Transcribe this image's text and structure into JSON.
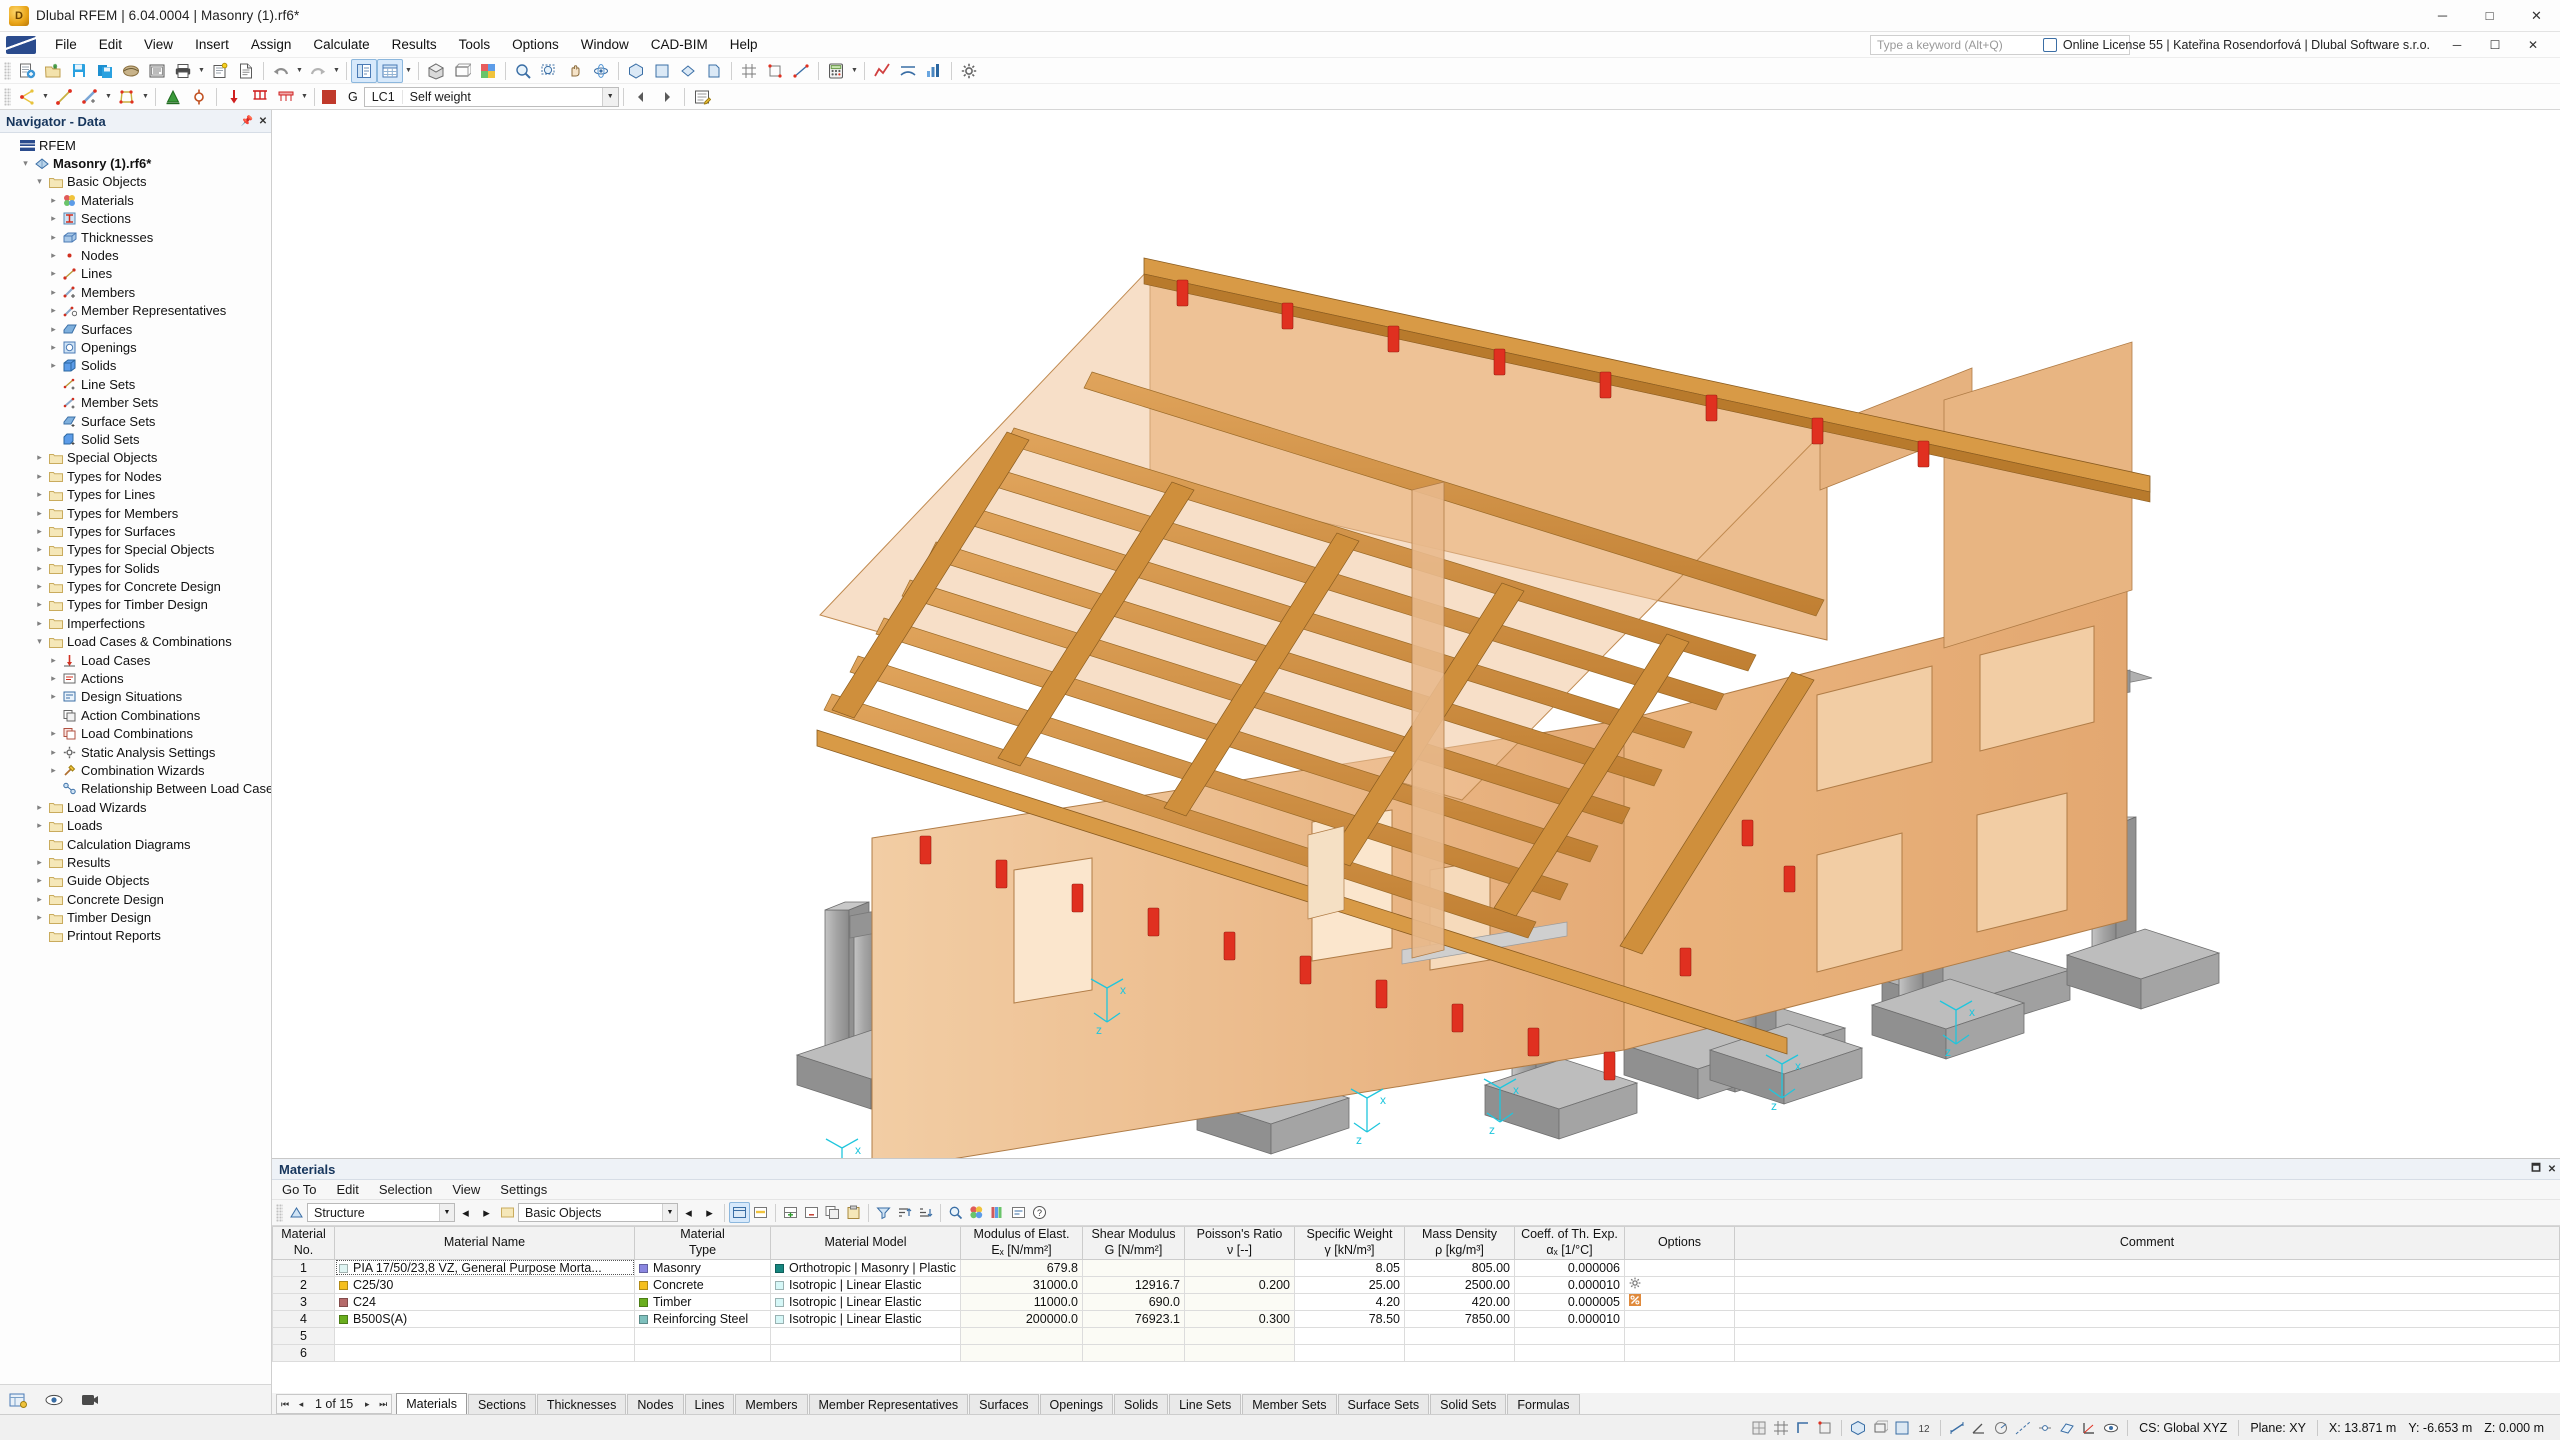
{
  "window": {
    "title": "Dlubal RFEM | 6.04.0004 | Masonry (1).rf6*",
    "app_icon": "dlubal-icon",
    "minimize": "─",
    "maximize": "□",
    "close": "✕"
  },
  "menubar": {
    "items": [
      "File",
      "Edit",
      "View",
      "Insert",
      "Assign",
      "Calculate",
      "Results",
      "Tools",
      "Options",
      "Window",
      "CAD-BIM",
      "Help"
    ],
    "search_placeholder": "Type a keyword (Alt+Q)",
    "license": "Online License 55 | Kateřina Rosendorfová | Dlubal Software s.r.o."
  },
  "toolbar2": {
    "lc_label": "G",
    "lc_value": "LC1",
    "lc_name": "Self weight",
    "view_value": ""
  },
  "navigator": {
    "title": "Navigator - Data",
    "root": "RFEM",
    "tree": [
      {
        "label": "RFEM",
        "indent": 0,
        "twisty": "",
        "icon": "rfem-logo-icon",
        "bold": false
      },
      {
        "label": "Masonry (1).rf6*",
        "indent": 1,
        "twisty": "⌄",
        "icon": "model-icon",
        "bold": true
      },
      {
        "label": "Basic Objects",
        "indent": 2,
        "twisty": "⌄",
        "icon": "folder-icon",
        "bold": false
      },
      {
        "label": "Materials",
        "indent": 3,
        "twisty": "›",
        "icon": "materials-icon",
        "bold": false
      },
      {
        "label": "Sections",
        "indent": 3,
        "twisty": "›",
        "icon": "sections-icon",
        "bold": false
      },
      {
        "label": "Thicknesses",
        "indent": 3,
        "twisty": "›",
        "icon": "thicknesses-icon",
        "bold": false
      },
      {
        "label": "Nodes",
        "indent": 3,
        "twisty": "›",
        "icon": "nodes-icon",
        "bold": false
      },
      {
        "label": "Lines",
        "indent": 3,
        "twisty": "›",
        "icon": "lines-icon",
        "bold": false
      },
      {
        "label": "Members",
        "indent": 3,
        "twisty": "›",
        "icon": "members-icon",
        "bold": false
      },
      {
        "label": "Member Representatives",
        "indent": 3,
        "twisty": "›",
        "icon": "member-representatives-icon",
        "bold": false
      },
      {
        "label": "Surfaces",
        "indent": 3,
        "twisty": "›",
        "icon": "surfaces-icon",
        "bold": false
      },
      {
        "label": "Openings",
        "indent": 3,
        "twisty": "›",
        "icon": "openings-icon",
        "bold": false
      },
      {
        "label": "Solids",
        "indent": 3,
        "twisty": "›",
        "icon": "solids-icon",
        "bold": false
      },
      {
        "label": "Line Sets",
        "indent": 3,
        "twisty": "",
        "icon": "line-sets-icon",
        "bold": false
      },
      {
        "label": "Member Sets",
        "indent": 3,
        "twisty": "",
        "icon": "member-sets-icon",
        "bold": false
      },
      {
        "label": "Surface Sets",
        "indent": 3,
        "twisty": "",
        "icon": "surface-sets-icon",
        "bold": false
      },
      {
        "label": "Solid Sets",
        "indent": 3,
        "twisty": "",
        "icon": "solid-sets-icon",
        "bold": false
      },
      {
        "label": "Special Objects",
        "indent": 2,
        "twisty": "›",
        "icon": "folder-icon",
        "bold": false
      },
      {
        "label": "Types for Nodes",
        "indent": 2,
        "twisty": "›",
        "icon": "folder-icon",
        "bold": false
      },
      {
        "label": "Types for Lines",
        "indent": 2,
        "twisty": "›",
        "icon": "folder-icon",
        "bold": false
      },
      {
        "label": "Types for Members",
        "indent": 2,
        "twisty": "›",
        "icon": "folder-icon",
        "bold": false
      },
      {
        "label": "Types for Surfaces",
        "indent": 2,
        "twisty": "›",
        "icon": "folder-icon",
        "bold": false
      },
      {
        "label": "Types for Special Objects",
        "indent": 2,
        "twisty": "›",
        "icon": "folder-icon",
        "bold": false
      },
      {
        "label": "Types for Solids",
        "indent": 2,
        "twisty": "›",
        "icon": "folder-icon",
        "bold": false
      },
      {
        "label": "Types for Concrete Design",
        "indent": 2,
        "twisty": "›",
        "icon": "folder-icon",
        "bold": false
      },
      {
        "label": "Types for Timber Design",
        "indent": 2,
        "twisty": "›",
        "icon": "folder-icon",
        "bold": false
      },
      {
        "label": "Imperfections",
        "indent": 2,
        "twisty": "›",
        "icon": "folder-icon",
        "bold": false
      },
      {
        "label": "Load Cases & Combinations",
        "indent": 2,
        "twisty": "⌄",
        "icon": "folder-icon",
        "bold": false
      },
      {
        "label": "Load Cases",
        "indent": 3,
        "twisty": "›",
        "icon": "load-cases-icon",
        "bold": false
      },
      {
        "label": "Actions",
        "indent": 3,
        "twisty": "›",
        "icon": "actions-icon",
        "bold": false
      },
      {
        "label": "Design Situations",
        "indent": 3,
        "twisty": "›",
        "icon": "design-situations-icon",
        "bold": false
      },
      {
        "label": "Action Combinations",
        "indent": 3,
        "twisty": "",
        "icon": "action-combinations-icon",
        "bold": false
      },
      {
        "label": "Load Combinations",
        "indent": 3,
        "twisty": "›",
        "icon": "load-combinations-icon",
        "bold": false
      },
      {
        "label": "Static Analysis Settings",
        "indent": 3,
        "twisty": "›",
        "icon": "static-analysis-settings-icon",
        "bold": false
      },
      {
        "label": "Combination Wizards",
        "indent": 3,
        "twisty": "›",
        "icon": "combination-wizards-icon",
        "bold": false
      },
      {
        "label": "Relationship Between Load Cases",
        "indent": 3,
        "twisty": "",
        "icon": "relationship-icon",
        "bold": false
      },
      {
        "label": "Load Wizards",
        "indent": 2,
        "twisty": "›",
        "icon": "folder-icon",
        "bold": false
      },
      {
        "label": "Loads",
        "indent": 2,
        "twisty": "›",
        "icon": "folder-icon",
        "bold": false
      },
      {
        "label": "Calculation Diagrams",
        "indent": 2,
        "twisty": "",
        "icon": "folder-icon",
        "bold": false
      },
      {
        "label": "Results",
        "indent": 2,
        "twisty": "›",
        "icon": "folder-icon",
        "bold": false
      },
      {
        "label": "Guide Objects",
        "indent": 2,
        "twisty": "›",
        "icon": "folder-icon",
        "bold": false
      },
      {
        "label": "Concrete Design",
        "indent": 2,
        "twisty": "›",
        "icon": "folder-icon",
        "bold": false
      },
      {
        "label": "Timber Design",
        "indent": 2,
        "twisty": "›",
        "icon": "folder-icon",
        "bold": false
      },
      {
        "label": "Printout Reports",
        "indent": 2,
        "twisty": "",
        "icon": "folder-icon",
        "bold": false
      }
    ]
  },
  "table_panel": {
    "title": "Materials",
    "menu": [
      "Go To",
      "Edit",
      "Selection",
      "View",
      "Settings"
    ],
    "combo_left": "Structure",
    "combo_right": "Basic Objects",
    "columns": [
      {
        "l1": "Material",
        "l2": "No."
      },
      {
        "l1": "",
        "l2": "Material Name"
      },
      {
        "l1": "Material",
        "l2": "Type"
      },
      {
        "l1": "",
        "l2": "Material Model"
      },
      {
        "l1": "Modulus of Elast.",
        "l2": "Eₓ [N/mm²]"
      },
      {
        "l1": "Shear Modulus",
        "l2": "G [N/mm²]"
      },
      {
        "l1": "Poisson's Ratio",
        "l2": "ν [--]"
      },
      {
        "l1": "Specific Weight",
        "l2": "γ [kN/m³]"
      },
      {
        "l1": "Mass Density",
        "l2": "ρ [kg/m³]"
      },
      {
        "l1": "Coeff. of Th. Exp.",
        "l2": "αₓ [1/°C]"
      },
      {
        "l1": "",
        "l2": "Options"
      },
      {
        "l1": "",
        "l2": "Comment"
      }
    ],
    "rows": [
      {
        "no": "1",
        "name": "PIA 17/50/23,8 VZ, General Purpose Morta...",
        "name_color": "#dff5f3",
        "type": "Masonry",
        "type_color": "#8a86e0",
        "model": "Orthotropic | Masonry | Plastic (...",
        "model_color": "#16867f",
        "e": "679.8",
        "g": "",
        "nu": "",
        "gamma": "8.05",
        "rho": "805.00",
        "alpha": "0.000006",
        "option": "",
        "comment": "",
        "selected": true
      },
      {
        "no": "2",
        "name": "C25/30",
        "name_color": "#f5bf1e",
        "type": "Concrete",
        "type_color": "#f5bf1e",
        "model": "Isotropic | Linear Elastic",
        "model_color": "#d6f7f7",
        "e": "31000.0",
        "g": "12916.7",
        "nu": "0.200",
        "gamma": "25.00",
        "rho": "2500.00",
        "alpha": "0.000010",
        "option": "gear",
        "comment": "",
        "selected": false
      },
      {
        "no": "3",
        "name": "C24",
        "name_color": "#b56a6a",
        "type": "Timber",
        "type_color": "#6aae1e",
        "model": "Isotropic | Linear Elastic",
        "model_color": "#d6f7f7",
        "e": "11000.0",
        "g": "690.0",
        "nu": "",
        "gamma": "4.20",
        "rho": "420.00",
        "alpha": "0.000005",
        "option": "percent",
        "comment": "",
        "selected": false
      },
      {
        "no": "4",
        "name": "B500S(A)",
        "name_color": "#6aae1e",
        "type": "Reinforcing Steel",
        "type_color": "#7ec0bd",
        "model": "Isotropic | Linear Elastic",
        "model_color": "#d6f7f7",
        "e": "200000.0",
        "g": "76923.1",
        "nu": "0.300",
        "gamma": "78.50",
        "rho": "7850.00",
        "alpha": "0.000010",
        "option": "",
        "comment": "",
        "selected": false
      },
      {
        "no": "5",
        "name": "",
        "name_color": "",
        "type": "",
        "type_color": "",
        "model": "",
        "model_color": "",
        "e": "",
        "g": "",
        "nu": "",
        "gamma": "",
        "rho": "",
        "alpha": "",
        "option": "",
        "comment": "",
        "selected": false
      },
      {
        "no": "6",
        "name": "",
        "name_color": "",
        "type": "",
        "type_color": "",
        "model": "",
        "model_color": "",
        "e": "",
        "g": "",
        "nu": "",
        "gamma": "",
        "rho": "",
        "alpha": "",
        "option": "",
        "comment": "",
        "selected": false
      }
    ],
    "pager": {
      "first": "⏮",
      "prev": "◂",
      "text": "1 of 15",
      "next": "▸",
      "last": "⏭"
    },
    "tabs": [
      {
        "label": "Materials",
        "active": true
      },
      {
        "label": "Sections",
        "active": false
      },
      {
        "label": "Thicknesses",
        "active": false
      },
      {
        "label": "Nodes",
        "active": false
      },
      {
        "label": "Lines",
        "active": false
      },
      {
        "label": "Members",
        "active": false
      },
      {
        "label": "Member Representatives",
        "active": false
      },
      {
        "label": "Surfaces",
        "active": false
      },
      {
        "label": "Openings",
        "active": false
      },
      {
        "label": "Solids",
        "active": false
      },
      {
        "label": "Line Sets",
        "active": false
      },
      {
        "label": "Member Sets",
        "active": false
      },
      {
        "label": "Surface Sets",
        "active": false
      },
      {
        "label": "Solid Sets",
        "active": false
      },
      {
        "label": "Formulas",
        "active": false
      }
    ]
  },
  "statusbar": {
    "cs": "CS: Global XYZ",
    "plane": "Plane: XY",
    "x": "X: 13.871 m",
    "y": "Y: -6.653 m",
    "z": "Z: 0.000 m"
  },
  "colors": {
    "masonry_wall": "#e9b27c",
    "masonry_wall_light": "#f0c79c",
    "timber": "#c98b3f",
    "timber_light": "#dda961",
    "concrete": "#9a9a9a",
    "support_red": "#e03020",
    "axis_cyan": "#2ad4e8",
    "accent_blue": "#2a4b8d"
  }
}
